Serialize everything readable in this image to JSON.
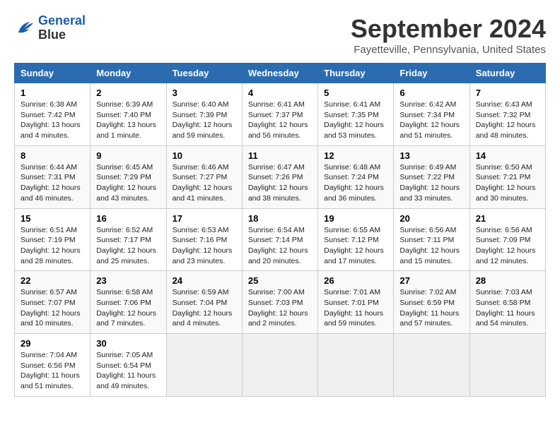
{
  "logo": {
    "line1": "General",
    "line2": "Blue"
  },
  "title": "September 2024",
  "location": "Fayetteville, Pennsylvania, United States",
  "days_of_week": [
    "Sunday",
    "Monday",
    "Tuesday",
    "Wednesday",
    "Thursday",
    "Friday",
    "Saturday"
  ],
  "weeks": [
    [
      {
        "num": "1",
        "rise": "6:38 AM",
        "set": "7:42 PM",
        "daylight": "13 hours and 4 minutes."
      },
      {
        "num": "2",
        "rise": "6:39 AM",
        "set": "7:40 PM",
        "daylight": "13 hours and 1 minute."
      },
      {
        "num": "3",
        "rise": "6:40 AM",
        "set": "7:39 PM",
        "daylight": "12 hours and 59 minutes."
      },
      {
        "num": "4",
        "rise": "6:41 AM",
        "set": "7:37 PM",
        "daylight": "12 hours and 56 minutes."
      },
      {
        "num": "5",
        "rise": "6:41 AM",
        "set": "7:35 PM",
        "daylight": "12 hours and 53 minutes."
      },
      {
        "num": "6",
        "rise": "6:42 AM",
        "set": "7:34 PM",
        "daylight": "12 hours and 51 minutes."
      },
      {
        "num": "7",
        "rise": "6:43 AM",
        "set": "7:32 PM",
        "daylight": "12 hours and 48 minutes."
      }
    ],
    [
      {
        "num": "8",
        "rise": "6:44 AM",
        "set": "7:31 PM",
        "daylight": "12 hours and 46 minutes."
      },
      {
        "num": "9",
        "rise": "6:45 AM",
        "set": "7:29 PM",
        "daylight": "12 hours and 43 minutes."
      },
      {
        "num": "10",
        "rise": "6:46 AM",
        "set": "7:27 PM",
        "daylight": "12 hours and 41 minutes."
      },
      {
        "num": "11",
        "rise": "6:47 AM",
        "set": "7:26 PM",
        "daylight": "12 hours and 38 minutes."
      },
      {
        "num": "12",
        "rise": "6:48 AM",
        "set": "7:24 PM",
        "daylight": "12 hours and 36 minutes."
      },
      {
        "num": "13",
        "rise": "6:49 AM",
        "set": "7:22 PM",
        "daylight": "12 hours and 33 minutes."
      },
      {
        "num": "14",
        "rise": "6:50 AM",
        "set": "7:21 PM",
        "daylight": "12 hours and 30 minutes."
      }
    ],
    [
      {
        "num": "15",
        "rise": "6:51 AM",
        "set": "7:19 PM",
        "daylight": "12 hours and 28 minutes."
      },
      {
        "num": "16",
        "rise": "6:52 AM",
        "set": "7:17 PM",
        "daylight": "12 hours and 25 minutes."
      },
      {
        "num": "17",
        "rise": "6:53 AM",
        "set": "7:16 PM",
        "daylight": "12 hours and 23 minutes."
      },
      {
        "num": "18",
        "rise": "6:54 AM",
        "set": "7:14 PM",
        "daylight": "12 hours and 20 minutes."
      },
      {
        "num": "19",
        "rise": "6:55 AM",
        "set": "7:12 PM",
        "daylight": "12 hours and 17 minutes."
      },
      {
        "num": "20",
        "rise": "6:56 AM",
        "set": "7:11 PM",
        "daylight": "12 hours and 15 minutes."
      },
      {
        "num": "21",
        "rise": "6:56 AM",
        "set": "7:09 PM",
        "daylight": "12 hours and 12 minutes."
      }
    ],
    [
      {
        "num": "22",
        "rise": "6:57 AM",
        "set": "7:07 PM",
        "daylight": "12 hours and 10 minutes."
      },
      {
        "num": "23",
        "rise": "6:58 AM",
        "set": "7:06 PM",
        "daylight": "12 hours and 7 minutes."
      },
      {
        "num": "24",
        "rise": "6:59 AM",
        "set": "7:04 PM",
        "daylight": "12 hours and 4 minutes."
      },
      {
        "num": "25",
        "rise": "7:00 AM",
        "set": "7:03 PM",
        "daylight": "12 hours and 2 minutes."
      },
      {
        "num": "26",
        "rise": "7:01 AM",
        "set": "7:01 PM",
        "daylight": "11 hours and 59 minutes."
      },
      {
        "num": "27",
        "rise": "7:02 AM",
        "set": "6:59 PM",
        "daylight": "11 hours and 57 minutes."
      },
      {
        "num": "28",
        "rise": "7:03 AM",
        "set": "6:58 PM",
        "daylight": "11 hours and 54 minutes."
      }
    ],
    [
      {
        "num": "29",
        "rise": "7:04 AM",
        "set": "6:56 PM",
        "daylight": "11 hours and 51 minutes."
      },
      {
        "num": "30",
        "rise": "7:05 AM",
        "set": "6:54 PM",
        "daylight": "11 hours and 49 minutes."
      },
      null,
      null,
      null,
      null,
      null
    ]
  ]
}
